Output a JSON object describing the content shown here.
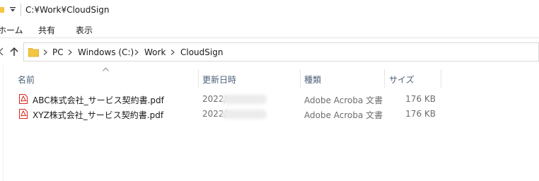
{
  "window": {
    "title": "C:¥Work¥CloudSign"
  },
  "ribbon": {
    "tabs": [
      "ホーム",
      "共有",
      "表示"
    ]
  },
  "address": {
    "crumbs": [
      "PC",
      "Windows (C:)",
      "Work",
      "CloudSign"
    ]
  },
  "columns": {
    "name": "名前",
    "date": "更新日時",
    "type": "種類",
    "size": "サイズ",
    "sorted_by": "名前",
    "sort_direction": "ascending"
  },
  "files": [
    {
      "name": "ABC株式会社_サービス契約書.pdf",
      "date_visible": "2022/",
      "type": "Adobe Acroba 文書",
      "size": "176 KB",
      "icon": "pdf-icon"
    },
    {
      "name": "XYZ株式会社_サービス契約書.pdf",
      "date_visible": "2022/",
      "type": "Adobe Acroba 文書",
      "size": "176 KB",
      "icon": "pdf-icon"
    }
  ],
  "colors": {
    "folder": "#f5c542",
    "pdf_red": "#d9261c",
    "header_text": "#4c607a",
    "detail_text": "#6d6d6d"
  }
}
